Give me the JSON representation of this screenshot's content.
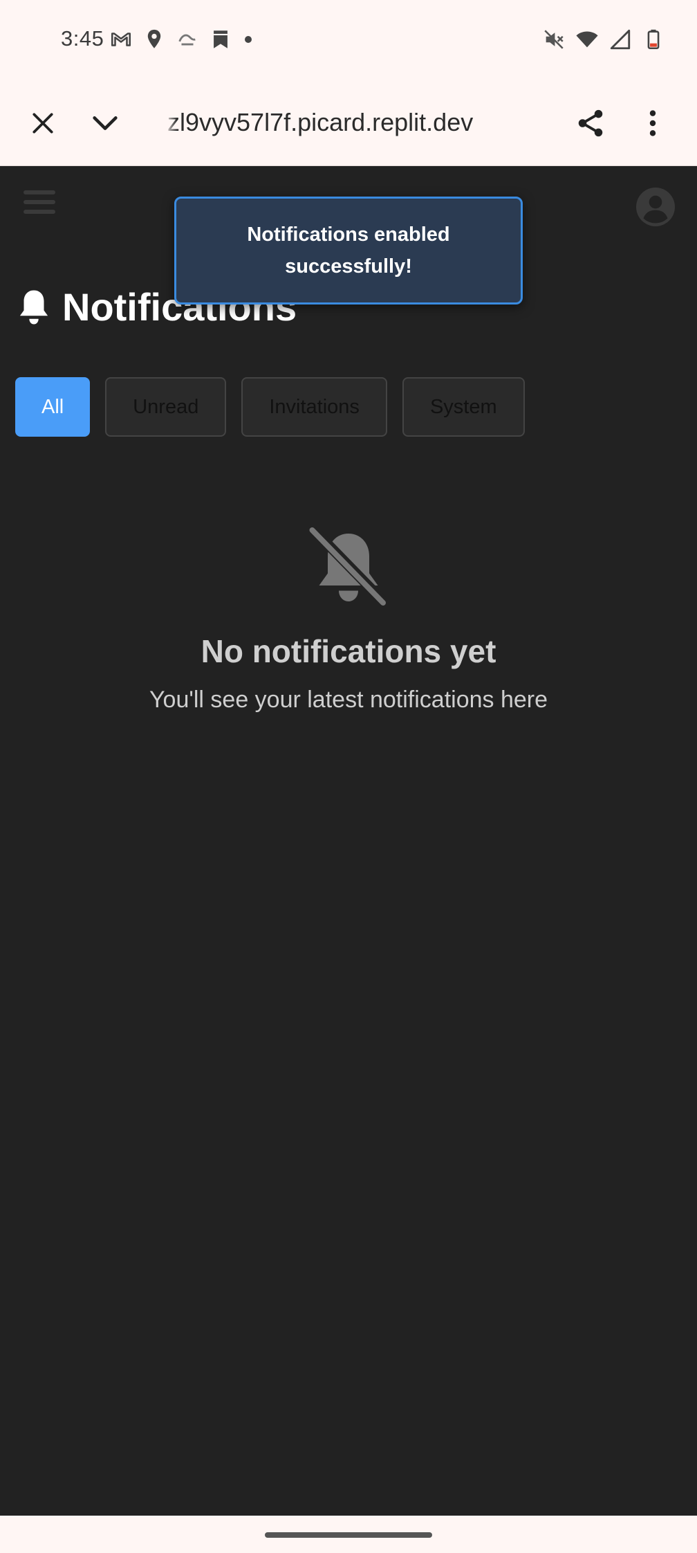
{
  "status_bar": {
    "time": "3:45",
    "left_icons": [
      "gmail-icon",
      "location-icon",
      "activity-icon",
      "bookmark-icon",
      "dot-icon"
    ],
    "right_icons": [
      "mute-icon",
      "wifi-icon",
      "signal-icon",
      "battery-icon"
    ]
  },
  "browser": {
    "url": "zl9vyv57l7f.picard.replit.dev",
    "buttons": [
      "close",
      "collapse",
      "share",
      "more"
    ]
  },
  "page": {
    "title": "Notifications",
    "tabs": [
      {
        "label": "All",
        "active": true
      },
      {
        "label": "Unread",
        "active": false
      },
      {
        "label": "Invitations",
        "active": false
      },
      {
        "label": "System",
        "active": false
      }
    ],
    "empty_state": {
      "title": "No notifications yet",
      "subtitle": "You'll see your latest notifications here"
    }
  },
  "toast": {
    "message": "Notifications enabled successfully!"
  },
  "colors": {
    "background": "#222222",
    "accent": "#4a9df8",
    "toast_bg": "#2b3b52",
    "toast_border": "#3a8be0",
    "browser_bar": "#fff6f4"
  }
}
